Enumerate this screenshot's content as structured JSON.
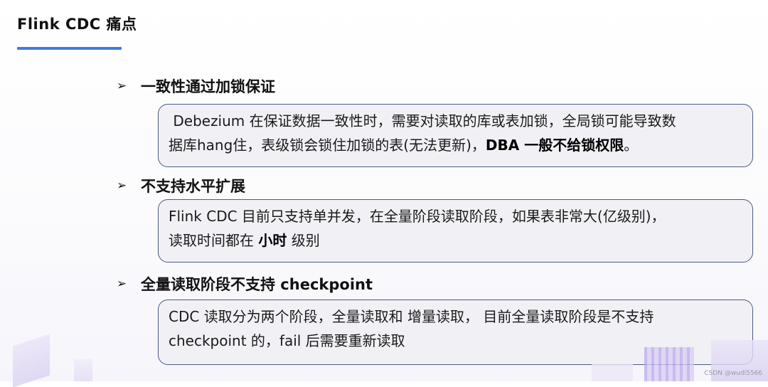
{
  "title": "Flink CDC 痛点",
  "sections": [
    {
      "heading": "一致性通过加锁保证",
      "body": {
        "line1": " Debezium 在保证数据一致性时，需要对读取的库或表加锁，全局锁可能导致数",
        "line2_pre": "据库hang住，表级锁会锁住加锁的表(无法更新)，",
        "line2_bold": "DBA 一般不给锁权限",
        "line2_post": "。"
      }
    },
    {
      "heading": "不支持水平扩展",
      "body": {
        "line1": "Flink CDC 目前只支持单并发，在全量阶段读取阶段，如果表非常大(亿级别)，",
        "line2_pre": "读取时间都在 ",
        "line2_bold": "小时",
        "line2_post": " 级别"
      }
    },
    {
      "heading": "全量读取阶段不支持 checkpoint",
      "body": {
        "line1": "CDC 读取分为两个阶段，全量读取和 增量读取， 目前全量读取阶段是不支持",
        "line2": "checkpoint 的，fail 后需要重新读取"
      }
    }
  ],
  "bullet_icon": "arrowhead-bullet-icon",
  "watermark": "CSDN @wudl5566",
  "colors": {
    "accent": "#3f7bea",
    "box_border": "#4c5a85",
    "box_fill": "#f1f1f5"
  }
}
